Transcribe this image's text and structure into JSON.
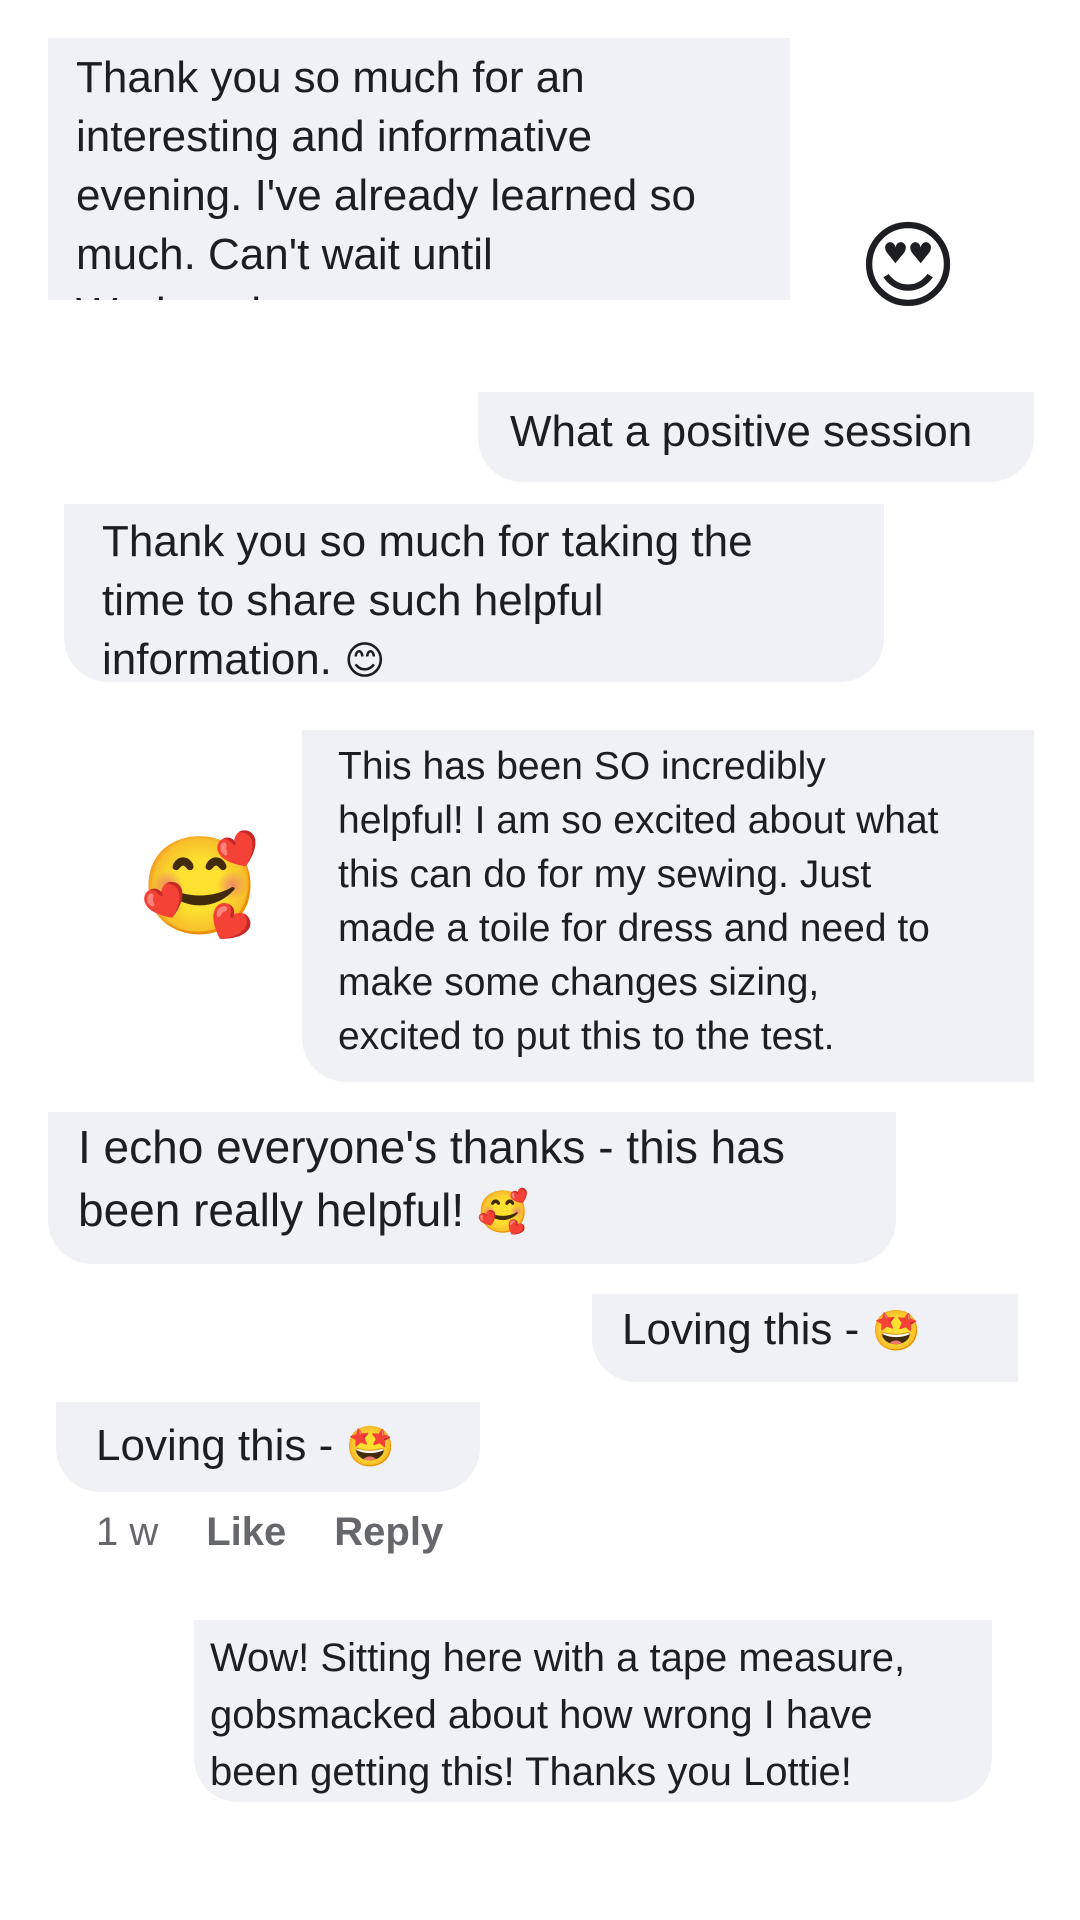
{
  "comments": [
    {
      "text": "Thank you so much for an\ninteresting and informative\nevening. I've already learned so\nmuch. Can't wait until\nWednesday.",
      "reaction_emoji": "😍"
    },
    {
      "text": "What a positive session"
    },
    {
      "text": "Thank you so much for taking the\ntime to share such helpful\ninformation. ",
      "emoji": "😊"
    },
    {
      "text": "This has been SO incredibly\nhelpful! I am so excited about what\nthis can do for my sewing. Just\nmade a toile for dress and need to\nmake some changes sizing,\nexcited to put this to the test.",
      "reaction_emoji": "🥰"
    },
    {
      "text": "I echo everyone's thanks - this has\nbeen really helpful! ",
      "emoji": "🥰"
    },
    {
      "text": "Loving this - ",
      "emoji": "🤩"
    },
    {
      "text": "Loving this - ",
      "emoji": "🤩",
      "meta": {
        "time": "1 w",
        "like": "Like",
        "reply": "Reply"
      }
    },
    {
      "text": "Wow! Sitting here with a tape measure,\ngobsmacked about how wrong I have\nbeen getting this! Thanks you Lottie!"
    }
  ],
  "colors": {
    "bubble_bg": "#eff1f4",
    "text": "#1c1e21",
    "meta": "#65676b"
  }
}
